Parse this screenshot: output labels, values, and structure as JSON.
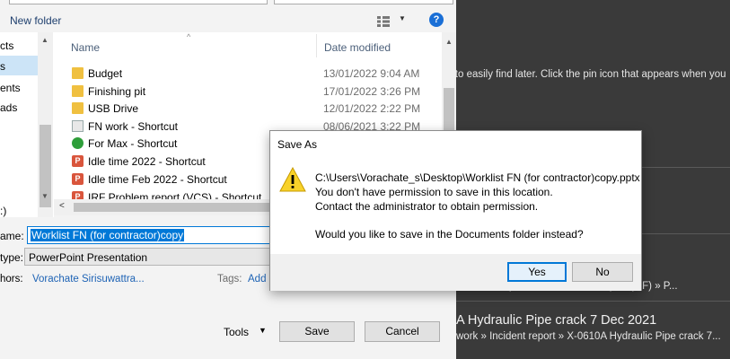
{
  "background_app": {
    "hint_text": "nt to easily find later. Click the pin icon that appears when you",
    "breadcrumb_1": "...» Incident report » X-0...  ...ment report (MF) » P...",
    "item_title": "A Hydraulic Pipe crack 7 Dec 2021",
    "item_path": "work » Incident report » X-0610A Hydraulic Pipe crack 7..."
  },
  "file_dialog": {
    "toolbar": {
      "new_folder": "New folder",
      "help": "?"
    },
    "nav": {
      "items": [
        "cts",
        "s",
        "ents",
        "ads",
        ":)"
      ]
    },
    "columns": {
      "name": "Name",
      "date_modified": "Date modified"
    },
    "files": [
      {
        "name": "Budget",
        "date": "13/01/2022 9:04 AM",
        "icon": "folder-icon"
      },
      {
        "name": "Finishing pit",
        "date": "17/01/2022 3:26 PM",
        "icon": "folder-icon"
      },
      {
        "name": "USB Drive",
        "date": "12/01/2022 2:22 PM",
        "icon": "folder-icon"
      },
      {
        "name": "FN work - Shortcut",
        "date": "08/06/2021 3:22 PM",
        "icon": "shortcut-icon"
      },
      {
        "name": "For Max - Shortcut",
        "date": "",
        "icon": "globe-shortcut-icon"
      },
      {
        "name": "Idle time 2022 - Shortcut",
        "date": "",
        "icon": "ppt-shortcut-icon"
      },
      {
        "name": "Idle time Feb 2022 - Shortcut",
        "date": "",
        "icon": "ppt-shortcut-icon"
      },
      {
        "name": "IRF Problem report (VCS) - Shortcut",
        "date": "",
        "icon": "ppt-shortcut-icon"
      }
    ],
    "form": {
      "file_name_label": "ame:",
      "file_name_value": "Worklist FN (for contractor)copy",
      "save_type_label": "type:",
      "save_type_value": "PowerPoint Presentation",
      "authors_label": "hors:",
      "authors_value": "Vorachate Sirisuwattra...",
      "tags_label": "Tags:",
      "tags_value": "Add"
    },
    "footer": {
      "tools": "Tools",
      "save": "Save",
      "cancel": "Cancel"
    }
  },
  "message_box": {
    "title": "Save As",
    "lines": [
      "C:\\Users\\Vorachate_s\\Desktop\\Worklist FN (for contractor)copy.pptx",
      "You don't have permission to save in this location.",
      "Contact the administrator to obtain permission.",
      "Would you like to save in the Documents folder instead?"
    ],
    "yes": "Yes",
    "no": "No"
  }
}
